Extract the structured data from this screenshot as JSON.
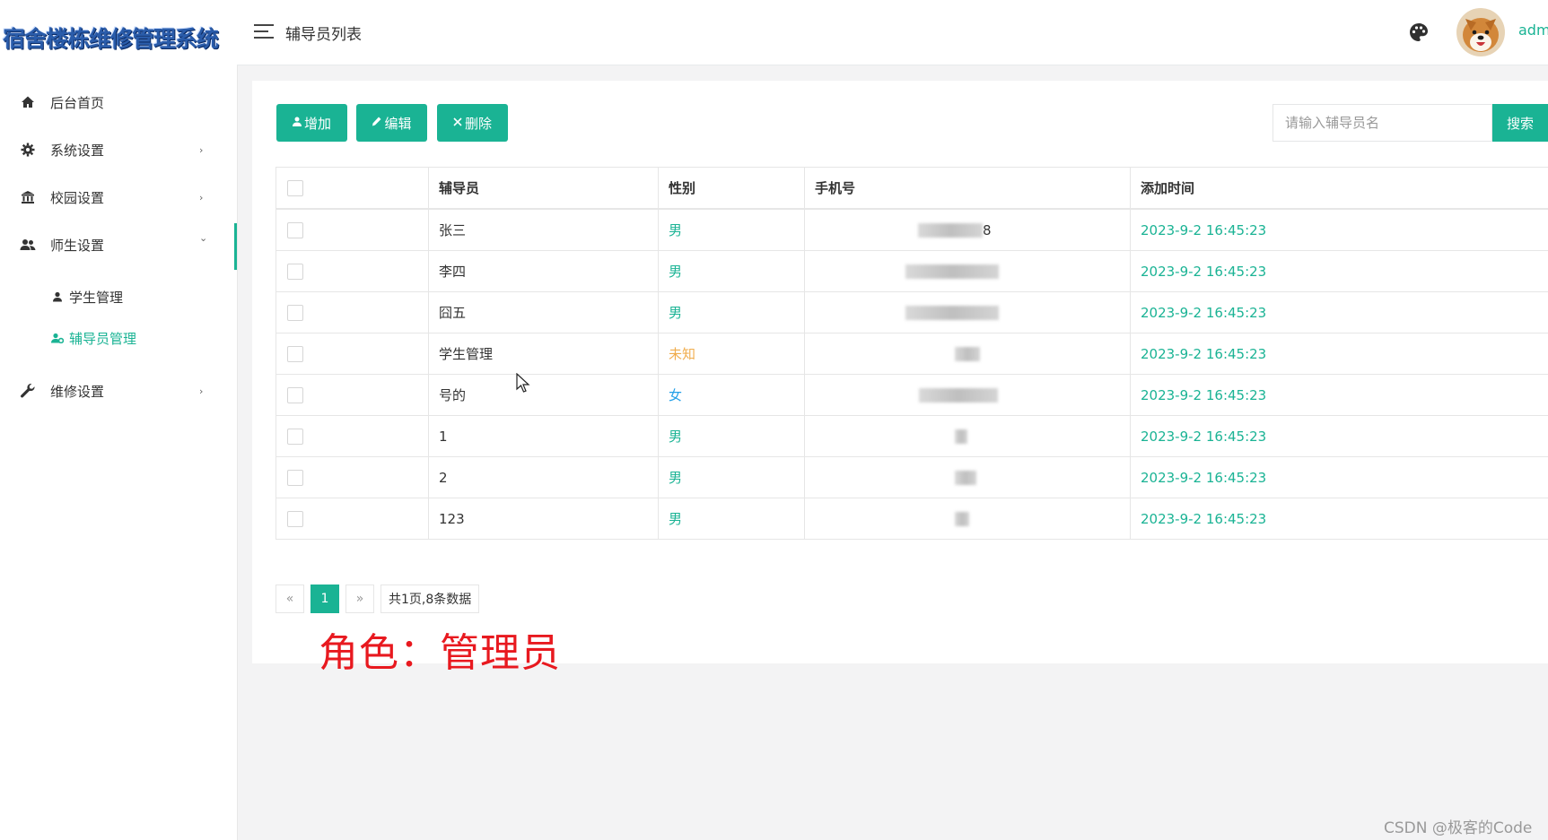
{
  "app": {
    "logo_text": "宿舍楼栋维修管理系统"
  },
  "sidebar": {
    "items": [
      {
        "label": "后台首页",
        "icon": "home-icon"
      },
      {
        "label": "系统设置",
        "icon": "gear-icon",
        "arrow": "›"
      },
      {
        "label": "校园设置",
        "icon": "bank-icon",
        "arrow": "›"
      },
      {
        "label": "师生设置",
        "icon": "users-icon",
        "arrow": "⌄"
      },
      {
        "label": "维修设置",
        "icon": "wrench-icon",
        "arrow": "›"
      }
    ],
    "subitems": [
      {
        "label": "学生管理",
        "icon": "user-icon"
      },
      {
        "label": "辅导员管理",
        "icon": "user-gear-icon",
        "active": true
      }
    ]
  },
  "header": {
    "title": "辅导员列表",
    "user_name": "adm"
  },
  "toolbar": {
    "add_label": "增加",
    "edit_label": "编辑",
    "delete_label": "删除",
    "search_placeholder": "请输入辅导员名",
    "search_label": "搜索"
  },
  "table": {
    "columns": [
      "辅导员",
      "性别",
      "手机号",
      "添加时间"
    ],
    "rows": [
      {
        "name": "张三",
        "gender": "男",
        "phone": "8",
        "added": "2023-9-2 16:45:23"
      },
      {
        "name": "李四",
        "gender": "男",
        "phone": "",
        "added": "2023-9-2 16:45:23"
      },
      {
        "name": "囧五",
        "gender": "男",
        "phone": "",
        "added": "2023-9-2 16:45:23"
      },
      {
        "name": "学生管理",
        "gender": "未知",
        "phone": "",
        "added": "2023-9-2 16:45:23"
      },
      {
        "name": "号的",
        "gender": "女",
        "phone": "",
        "added": "2023-9-2 16:45:23"
      },
      {
        "name": "1",
        "gender": "男",
        "phone": "",
        "added": "2023-9-2 16:45:23"
      },
      {
        "name": "2",
        "gender": "男",
        "phone": "",
        "added": "2023-9-2 16:45:23"
      },
      {
        "name": "123",
        "gender": "男",
        "phone": "",
        "added": "2023-9-2 16:45:23"
      }
    ]
  },
  "pagination": {
    "prev": "«",
    "current": "1",
    "next": "»",
    "info": "共1页,8条数据"
  },
  "caption": "角色：管理员",
  "watermark": "CSDN @极客的Code",
  "colors": {
    "accent": "#1ab394",
    "caption": "#e8191f",
    "unknown": "#f0ad4e",
    "female": "#23a0e8"
  }
}
